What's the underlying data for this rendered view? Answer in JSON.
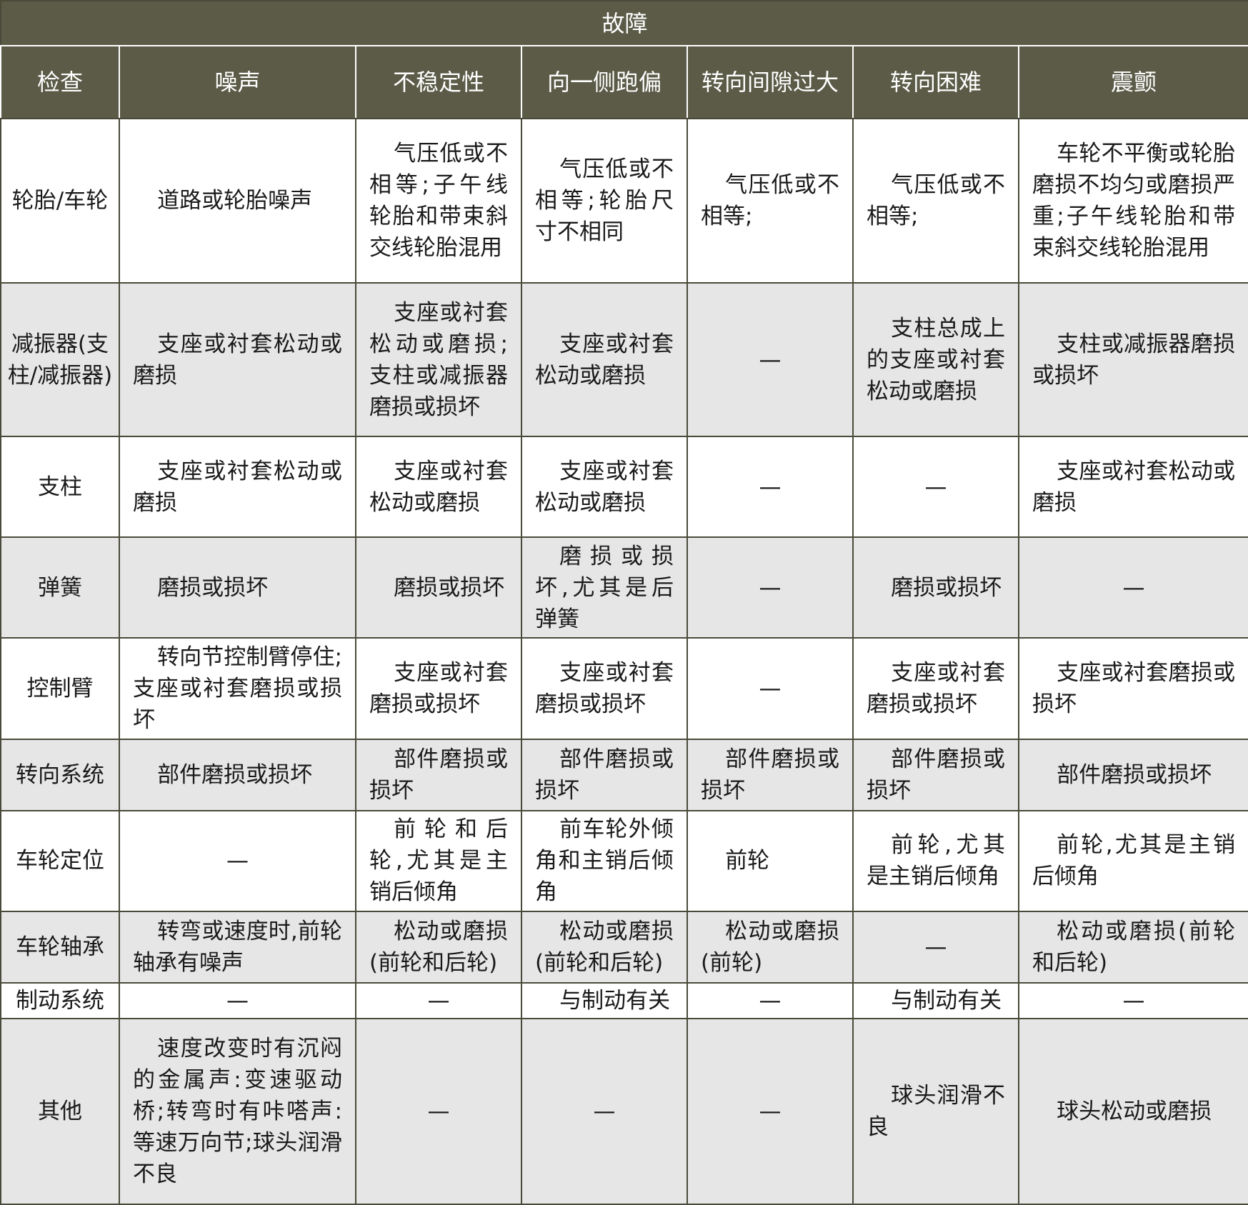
{
  "table": {
    "super_header": "故障",
    "columns": [
      "检查",
      "噪声",
      "不稳定性",
      "向一侧跑偏",
      "转向间隙过大",
      "转向困难",
      "震颤"
    ],
    "rows": [
      {
        "label": "轮胎/车轮",
        "cells": [
          "道路或轮胎噪声",
          "气压低或不相等;子午线轮胎和带束斜交线轮胎混用",
          "气压低或不相等;轮胎尺寸不相同",
          "气压低或不相等;",
          "气压低或不相等;",
          "车轮不平衡或轮胎磨损不均匀或磨损严重;子午线轮胎和带束斜交线轮胎混用"
        ]
      },
      {
        "label": "减振器(支柱/减振器)",
        "cells": [
          "支座或衬套松动或磨损",
          "支座或衬套松动或磨损;支柱或减振器磨损或损坏",
          "支座或衬套松动或磨损",
          "—",
          "支柱总成上的支座或衬套松动或磨损",
          "支柱或减振器磨损或损坏"
        ]
      },
      {
        "label": "支柱",
        "cells": [
          "支座或衬套松动或磨损",
          "支座或衬套松动或磨损",
          "支座或衬套松动或磨损",
          "—",
          "—",
          "支座或衬套松动或磨损"
        ]
      },
      {
        "label": "弹簧",
        "cells": [
          "磨损或损坏",
          "磨损或损坏",
          "磨损或损坏,尤其是后弹簧",
          "—",
          "磨损或损坏",
          "—"
        ]
      },
      {
        "label": "控制臂",
        "cells": [
          "转向节控制臂停住;支座或衬套磨损或损坏",
          "支座或衬套磨损或损坏",
          "支座或衬套磨损或损坏",
          "—",
          "支座或衬套磨损或损坏",
          "支座或衬套磨损或损坏"
        ]
      },
      {
        "label": "转向系统",
        "cells": [
          "部件磨损或损坏",
          "部件磨损或损坏",
          "部件磨损或损坏",
          "部件磨损或损坏",
          "部件磨损或损坏",
          "部件磨损或损坏"
        ]
      },
      {
        "label": "车轮定位",
        "cells": [
          "—",
          "前轮和后轮,尤其是主销后倾角",
          "前车轮外倾角和主销后倾角",
          "前轮",
          "前轮,尤其是主销后倾角",
          "前轮,尤其是主销后倾角"
        ]
      },
      {
        "label": "车轮轴承",
        "cells": [
          "转弯或速度时,前轮轴承有噪声",
          "松动或磨损(前轮和后轮)",
          "松动或磨损(前轮和后轮)",
          "松动或磨损(前轮)",
          "—",
          "松动或磨损(前轮和后轮)"
        ]
      },
      {
        "label": "制动系统",
        "cells": [
          "—",
          "—",
          "与制动有关",
          "—",
          "与制动有关",
          "—"
        ]
      },
      {
        "label": "其他",
        "cells": [
          "速度改变时有沉闷的金属声:变速驱动桥;转弯时有咔嗒声:等速万向节;球头润滑不良",
          "—",
          "—",
          "—",
          "球头润滑不良",
          "球头松动或磨损"
        ]
      }
    ]
  }
}
